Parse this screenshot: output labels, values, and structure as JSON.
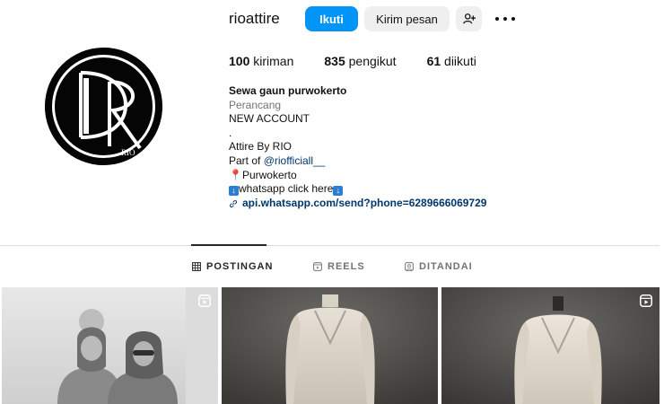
{
  "profile": {
    "username": "rioattire",
    "follow_label": "Ikuti",
    "message_label": "Kirim pesan"
  },
  "stats": {
    "posts_count": "100",
    "posts_label": " kiriman",
    "followers_count": "835",
    "followers_label": " pengikut",
    "following_count": "61",
    "following_label": " diikuti"
  },
  "bio": {
    "name": "Sewa gaun purwokerto",
    "category": "Perancang",
    "lines": [
      "NEW ACCOUNT",
      ".",
      "Attire By RIO"
    ],
    "part_of_prefix": "Part of ",
    "mention": "@riofficiall__",
    "location": "Purwokerto",
    "whatsapp_text": "whatsapp click here",
    "link": "api.whatsapp.com/send?phone=6289666069729"
  },
  "tabs": [
    {
      "label": "POSTINGAN",
      "icon": "grid-icon",
      "active": true
    },
    {
      "label": "REELS",
      "icon": "reels-icon",
      "active": false
    },
    {
      "label": "DITANDAI",
      "icon": "tagged-icon",
      "active": false
    }
  ],
  "icons": {
    "add_person": "add-person-icon",
    "more": "more-options-icon",
    "reel_badge": "reel-badge-icon",
    "pin": "map-pin-icon",
    "arrow": "down-arrow-icon",
    "link": "link-icon"
  },
  "colors": {
    "accent": "#0095f6",
    "link": "#00376b",
    "muted": "#737373"
  }
}
